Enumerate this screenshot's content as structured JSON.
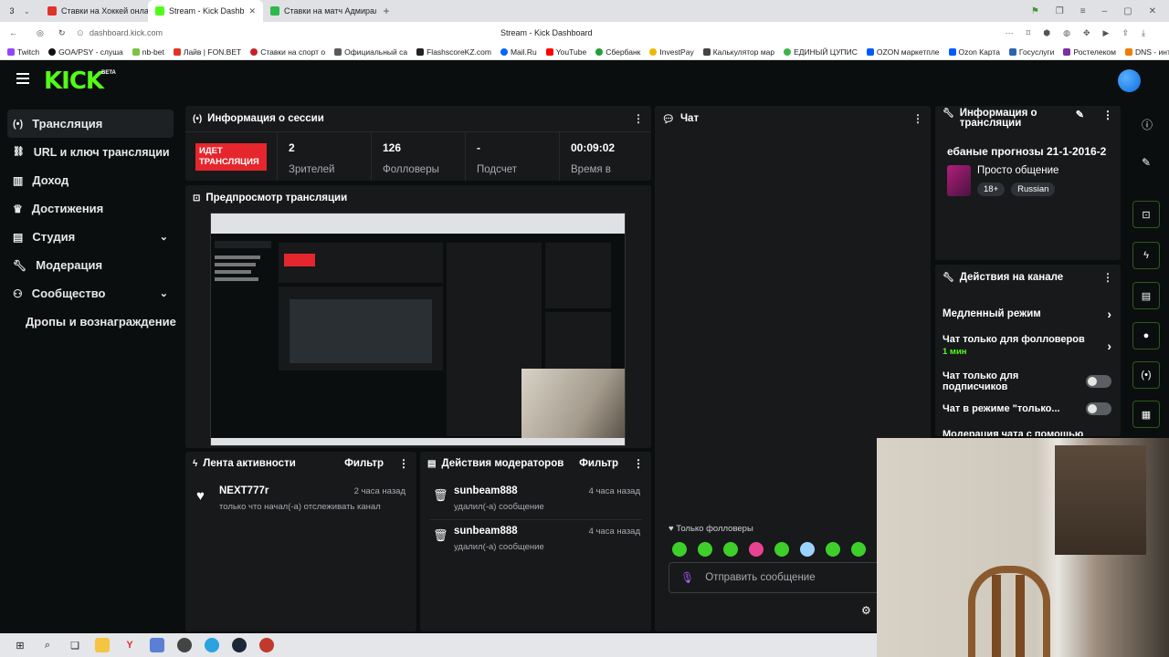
{
  "browser": {
    "tab_count": "3",
    "tabs": [
      {
        "label": "Ставки на Хоккей онлайн"
      },
      {
        "label": "Stream - Kick Dashboard"
      },
      {
        "label": "Ставки на матч Адмирал"
      }
    ],
    "url": "dashboard.kick.com",
    "page_title": "Stream - Kick Dashboard",
    "bookmarks": [
      "Twitch",
      "GOA/PSY - слуша",
      "nb-bet",
      "Лайв | FON.BET",
      "Ставки на спорт о",
      "Официальный са",
      "FlashscoreKZ.com",
      "Mail.Ru",
      "YouTube",
      "Сбербанк",
      "InvestPay",
      "Калькулятор мар",
      "ЕДИНЫЙ ЦУПИС",
      "OZON маркетпле",
      "Ozon Карта",
      "Госуслуги",
      "Ростелеком",
      "DNS - интер"
    ]
  },
  "app": {
    "logo": "KICK",
    "logo_badge": "BETA",
    "accent": "#53fc18"
  },
  "sidebar": {
    "items": [
      {
        "label": "Трансляция"
      },
      {
        "label": "URL и ключ трансляции"
      },
      {
        "label": "Доход"
      },
      {
        "label": "Достижения"
      },
      {
        "label": "Студия"
      },
      {
        "label": "Модерация"
      },
      {
        "label": "Сообщество"
      },
      {
        "label": "Дропы и вознаграждение"
      }
    ]
  },
  "session": {
    "title": "Информация о сессии",
    "live_badge": "ИДЕТ ТРАНСЛЯЦИЯ",
    "viewers_value": "2",
    "viewers_label": "Зрителей",
    "followers_value": "126",
    "followers_label": "Фолловеры",
    "subs_value": "-",
    "subs_label": "Подсчет",
    "time_value": "00:09:02",
    "time_label": "Время в"
  },
  "preview": {
    "title": "Предпросмотр трансляции"
  },
  "activity": {
    "title": "Лента активности",
    "filter": "Фильтр",
    "items": [
      {
        "user": "NEXT777r",
        "time": "2 часа назад",
        "text": "только что начал(-а) отслеживать канал"
      }
    ]
  },
  "mod_actions": {
    "title": "Действия модераторов",
    "filter": "Фильтр",
    "items": [
      {
        "user": "sunbeam888",
        "time": "4 часа назад",
        "text": "удалил(-а) сообщение"
      },
      {
        "user": "sunbeam888",
        "time": "4 часа назад",
        "text": "удалил(-а) сообщение"
      }
    ]
  },
  "chat": {
    "title": "Чат",
    "followers_only": "Только фолловеры",
    "placeholder": "Отправить сообщение"
  },
  "stream_info": {
    "title": "Информация о трансляции",
    "stream_title": "ебаные прогнозы 21-1-2016-2",
    "category": "Просто общение",
    "tags": [
      "18+",
      "Russian"
    ]
  },
  "channel_actions": {
    "title": "Действия на канале",
    "slow_mode": "Медленный режим",
    "followers_only": "Чат только для фолловеров",
    "followers_only_value": "1 мин",
    "subs_only": "Чат только для подписчиков",
    "emote_mode": "Чат в режиме \"только...",
    "moderation": "Модерация чата с помощью"
  }
}
